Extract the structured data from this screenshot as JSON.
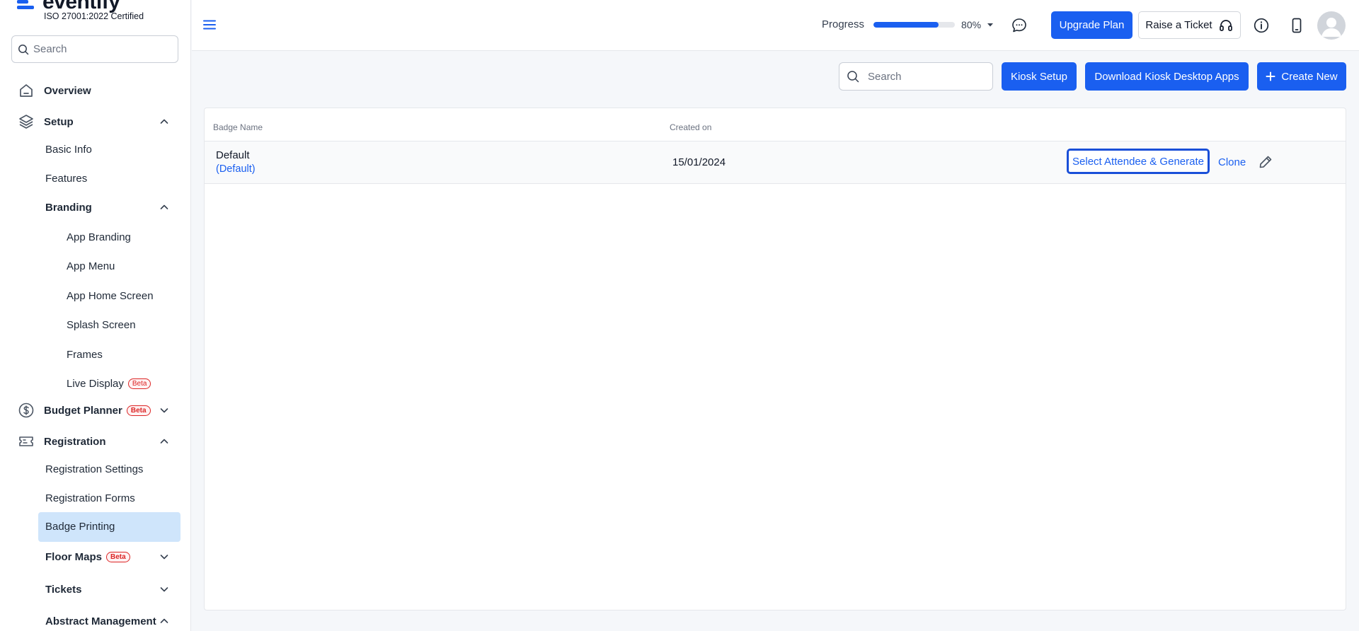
{
  "brand": {
    "name": "eventify",
    "certification": "ISO 27001:2022 Certified",
    "accent": "#1a5ff0"
  },
  "sidebar": {
    "search_placeholder": "Search",
    "items": [
      {
        "label": "Overview"
      },
      {
        "label": "Setup"
      },
      {
        "label": "Basic Info"
      },
      {
        "label": "Features"
      },
      {
        "label": "Branding"
      },
      {
        "label": "App Branding"
      },
      {
        "label": "App Menu"
      },
      {
        "label": "App Home Screen"
      },
      {
        "label": "Splash Screen"
      },
      {
        "label": "Frames"
      },
      {
        "label": "Live Display",
        "badge": "Beta"
      },
      {
        "label": "Budget Planner",
        "badge": "Beta"
      },
      {
        "label": "Registration"
      },
      {
        "label": "Registration Settings"
      },
      {
        "label": "Registration Forms"
      },
      {
        "label": "Badge Printing",
        "active": true
      },
      {
        "label": "Floor Maps",
        "badge": "Beta"
      },
      {
        "label": "Tickets"
      },
      {
        "label": "Abstract Management"
      }
    ]
  },
  "header": {
    "progress_label": "Progress",
    "progress_value": 80,
    "progress_text": "80%",
    "upgrade_label": "Upgrade Plan",
    "ticket_label": "Raise a Ticket"
  },
  "toolbar": {
    "search_placeholder": "Search",
    "kiosk_setup_label": "Kiosk Setup",
    "download_label": "Download Kiosk Desktop Apps",
    "create_label": "Create New"
  },
  "table": {
    "columns": [
      "Badge Name",
      "Created on"
    ],
    "rows": [
      {
        "name": "Default",
        "tag": "(Default)",
        "created_on": "15/01/2024",
        "action_primary": "Select Attendee & Generate",
        "action_clone": "Clone"
      }
    ]
  }
}
